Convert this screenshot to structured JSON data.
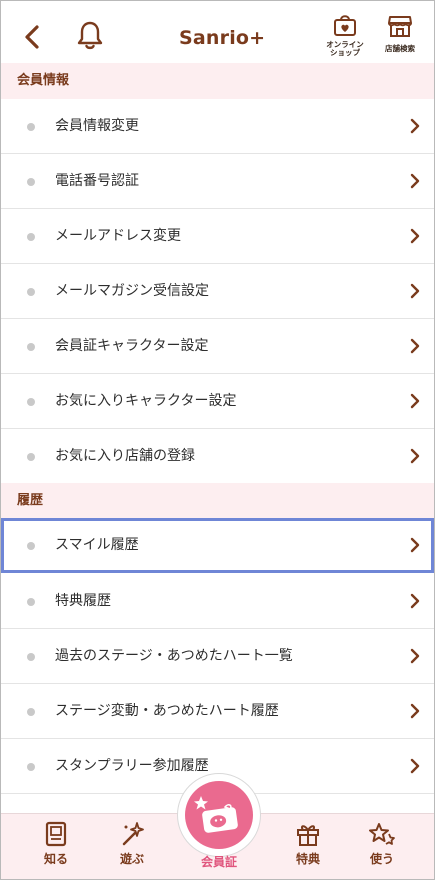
{
  "header": {
    "logo_text": "Sanrio+",
    "online_shop_line1": "オンライン",
    "online_shop_line2": "ショップ",
    "store_search_label": "店舗検索"
  },
  "sections": {
    "member": {
      "title": "会員情報",
      "items": [
        "会員情報変更",
        "電話番号認証",
        "メールアドレス変更",
        "メールマガジン受信設定",
        "会員証キャラクター設定",
        "お気に入りキャラクター設定",
        "お気に入り店舗の登録"
      ]
    },
    "history": {
      "title": "履歴",
      "items": [
        "スマイル履歴",
        "特典履歴",
        "過去のステージ・あつめたハート一覧",
        "ステージ変動・あつめたハート履歴",
        "スタンプラリー参加履歴"
      ]
    }
  },
  "tabbar": {
    "know": "知る",
    "play": "遊ぶ",
    "member_card": "会員証",
    "benefits": "特典",
    "use": "使う"
  },
  "colors": {
    "brand_brown": "#7a3b1d",
    "section_bg": "#fdeef0",
    "accent_pink": "#ea6a8f",
    "selection_blue": "#6f86d6"
  }
}
